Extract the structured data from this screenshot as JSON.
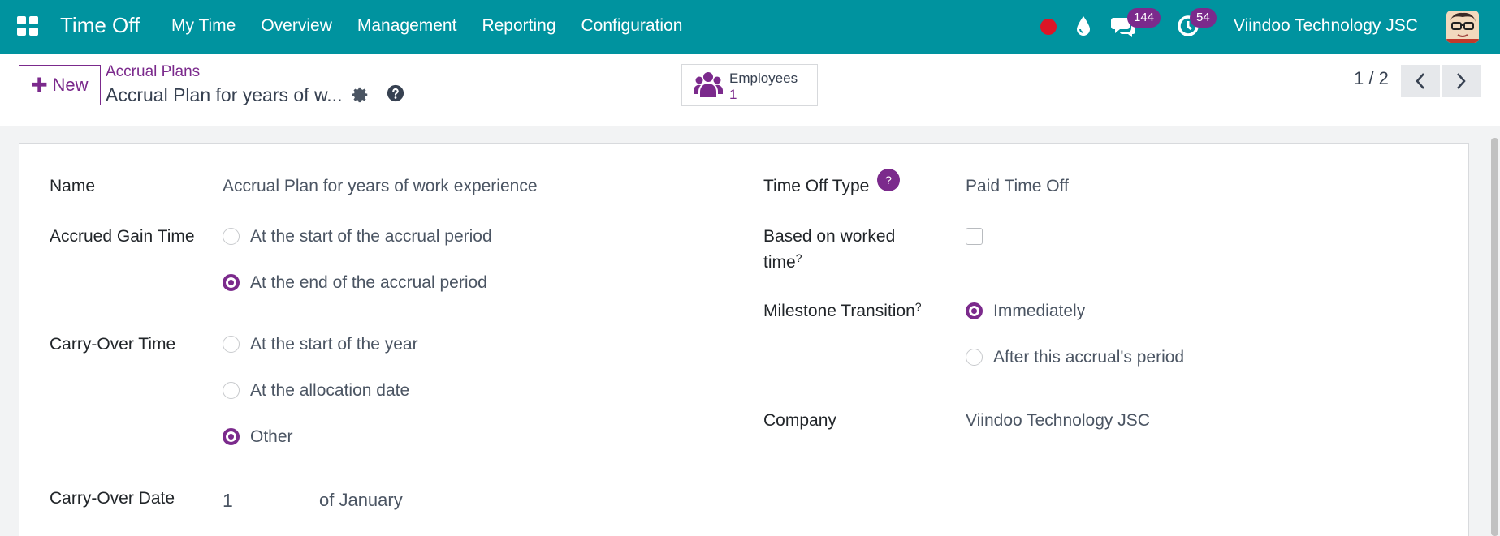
{
  "navbar": {
    "brand": "Time Off",
    "menu": [
      "My Time",
      "Overview",
      "Management",
      "Reporting",
      "Configuration"
    ],
    "messages_count": "144",
    "activities_count": "54",
    "company": "Viindoo Technology JSC",
    "colors": {
      "bar": "#00939f",
      "badge": "#7b2a8c",
      "record": "#dc1526"
    }
  },
  "control": {
    "new_label": "New",
    "breadcrumb": "Accrual Plans",
    "record_title": "Accrual Plan for years of w...",
    "smart_button": {
      "label": "Employees",
      "value": "1"
    },
    "pager": "1 / 2"
  },
  "form": {
    "name_label": "Name",
    "name_value": "Accrual Plan for years of work experience",
    "gain_label": "Accrued Gain Time",
    "gain_options": [
      {
        "label": "At the start of the accrual period",
        "checked": false
      },
      {
        "label": "At the end of the accrual period",
        "checked": true
      }
    ],
    "carry_label": "Carry-Over Time",
    "carry_options": [
      {
        "label": "At the start of the year",
        "checked": false
      },
      {
        "label": "At the allocation date",
        "checked": false
      },
      {
        "label": "Other",
        "checked": true
      }
    ],
    "carry_date_label": "Carry-Over Date",
    "carry_date_day": "1",
    "carry_date_month": "of January",
    "type_label": "Time Off Type",
    "type_help": "?",
    "type_value": "Paid Time Off",
    "worked_label_1": "Based on worked",
    "worked_label_2": "time",
    "worked_checked": false,
    "milestone_label": "Milestone Transition",
    "milestone_options": [
      {
        "label": "Immediately",
        "checked": true
      },
      {
        "label": "After this accrual's period",
        "checked": false
      }
    ],
    "company_label": "Company",
    "company_value": "Viindoo Technology JSC",
    "sup_mark": "?"
  }
}
